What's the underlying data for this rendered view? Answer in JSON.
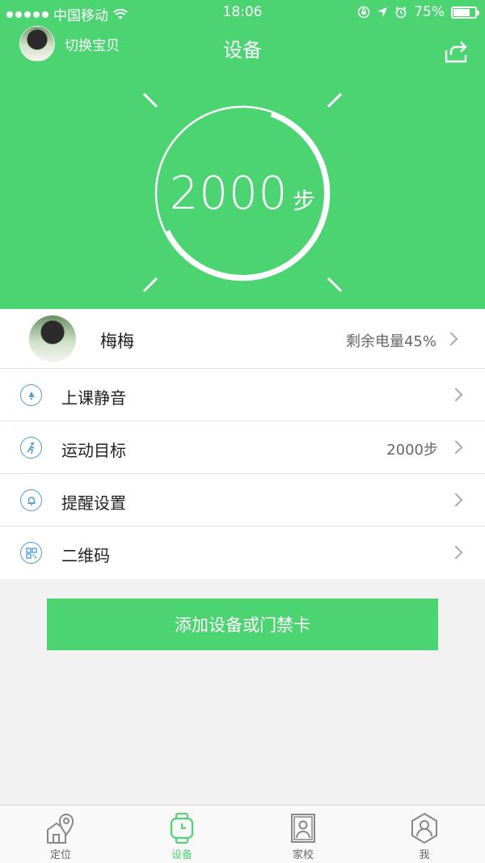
{
  "status_bar": {
    "carrier": "中国移动",
    "time": "18:06",
    "battery_percent": "75%",
    "battery_level": 0.75
  },
  "header": {
    "switch_label": "切换宝贝",
    "title": "设备",
    "steps_value": "2000",
    "steps_unit": "步",
    "ring_progress": 0.62,
    "background_color": "#4cd473"
  },
  "profile": {
    "name": "梅梅",
    "battery_text": "剩余电量45%"
  },
  "settings": [
    {
      "label": "上课静音",
      "value": "",
      "icon": "bell-mute-icon"
    },
    {
      "label": "运动目标",
      "value": "2000步",
      "icon": "running-person-icon"
    },
    {
      "label": "提醒设置",
      "value": "",
      "icon": "bell-icon"
    },
    {
      "label": "二维码",
      "value": "",
      "icon": "qr-code-icon"
    }
  ],
  "add_button_label": "添加设备或门禁卡",
  "tabs": [
    {
      "label": "定位",
      "icon": "location-icon",
      "active": false
    },
    {
      "label": "设备",
      "icon": "watch-icon",
      "active": true
    },
    {
      "label": "家校",
      "icon": "school-photo-icon",
      "active": false
    },
    {
      "label": "我",
      "icon": "profile-icon",
      "active": false
    }
  ],
  "colors": {
    "accent": "#4cd473",
    "icon_blue": "#4a98e0"
  }
}
